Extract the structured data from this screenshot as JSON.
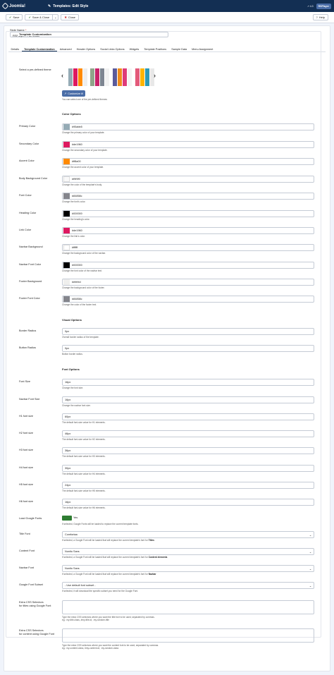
{
  "header": {
    "logo": "Joomla!",
    "title": "Templates: Edit Style",
    "ver": "↗ 4.3",
    "user": "RSPlayer"
  },
  "toolbar": {
    "save": "Save",
    "save_close": "Save & Close",
    "close": "Close",
    "help": "Help"
  },
  "style_name": {
    "label": "Style Name",
    "req": "*",
    "value": "RSPlayer - Full Width"
  },
  "tabs": [
    "Details",
    "Template Customization",
    "Advanced",
    "Header Options",
    "Social Links Options",
    "Widgets",
    "Template Positions",
    "Sample Data",
    "Menu Assignment"
  ],
  "legend": "Template Customization",
  "theme": {
    "label": "Select a pre-defined theme",
    "hint": "You can select one of the pre-defined themes",
    "customize": "Customize it!"
  },
  "sections": {
    "color": "Color Options",
    "visual": "Visual Options",
    "font": "Font Options"
  },
  "colors": [
    {
      "label": "Primary Color",
      "value": "#95abb5",
      "hint": "Change the primary color of your template."
    },
    {
      "label": "Secondary Color",
      "value": "#de1960",
      "hint": "Change the secondary color of your template."
    },
    {
      "label": "Accent Color",
      "value": "#ff8a00",
      "hint": "Change the accent color of your template."
    },
    {
      "label": "Body Background Color",
      "value": "#f9f9f9",
      "hint": "Change the color of the template's body."
    },
    {
      "label": "Font Color",
      "value": "#84858c",
      "hint": "Change the font's color."
    },
    {
      "label": "Heading Color",
      "value": "#000000",
      "hint": "Change the heading's color."
    },
    {
      "label": "Link Color",
      "value": "#de1960",
      "hint": "Change the link's color."
    },
    {
      "label": "Navbar Background",
      "value": "#ffffff",
      "hint": "Change the background color of the navbar."
    },
    {
      "label": "Navbar Font Color",
      "value": "#000000",
      "hint": "Change the font color of the navbar text."
    },
    {
      "label": "Footer Background",
      "value": "#efefed",
      "hint": "Change the background color of the footer."
    },
    {
      "label": "Footer Font Color",
      "value": "#84858c",
      "hint": "Change the color of the footer text."
    }
  ],
  "visual": [
    {
      "label": "Border Radius",
      "value": "0px",
      "hint": "Overall border radius of the template."
    },
    {
      "label": "Button Radius",
      "value": "0px",
      "hint": "Button border radius."
    }
  ],
  "fonts": [
    {
      "label": "Font Size",
      "value": "16px",
      "hint": "Change the font size."
    },
    {
      "label": "Navbar Font Size",
      "value": "16px",
      "hint": "Change the navbar font size."
    },
    {
      "label": "H1 font size",
      "value": "60px",
      "hint": "The default font-size value for H1 elements."
    },
    {
      "label": "H2 font size",
      "value": "46px",
      "hint": "The default font-size value for H2 elements."
    },
    {
      "label": "H3 font size",
      "value": "36px",
      "hint": "The default font-size value for H3 elements."
    },
    {
      "label": "H4 font size",
      "value": "30px",
      "hint": "The default font-size value for H4 elements."
    },
    {
      "label": "H5 font size",
      "value": "24px",
      "hint": "The default font-size value for H5 elements."
    },
    {
      "label": "H6 font size",
      "value": "16px",
      "hint": "The default font-size value for H6 elements."
    }
  ],
  "google": {
    "label": "Load Google Fonts",
    "value": "Yes",
    "hint": "If selected, Google Fonts will be loaded to replace the current template fonts."
  },
  "selects": [
    {
      "label": "Title Font",
      "value": "Comfortaa",
      "hint_pre": "If selected, a Google Font will be loaded that will replace the current template's font for ",
      "hint_b": "Titles"
    },
    {
      "label": "Content Font",
      "value": "Nunito Sans",
      "hint_pre": "If selected, a Google Font will be loaded that will replace the current template's font for ",
      "hint_b": "Content elements"
    },
    {
      "label": "Navbar Font",
      "value": "Nunito Sans",
      "hint_pre": "If selected, a Google Font will be loaded that will replace the current template's font for ",
      "hint_b": "Navbar"
    },
    {
      "label": "Google Font Subset",
      "value": "- Use default font subset -",
      "hint_pre": "If selected, it will download the specific subset you need for the Google Font.",
      "hint_b": ""
    }
  ],
  "extra": [
    {
      "l1": "Extra CSS Selectors",
      "l2": "for titles using Google Font",
      "h1": "Type the extra CSS selectors where you want the title font to be used, separated by commas.",
      "h2": "eg.: my-title-class, #my-title-id, .my-random-title"
    },
    {
      "l1": "Extra CSS Selectors",
      "l2": "for content using Google Font",
      "h1": "Type the extra CSS selectors where you want the content font to be used, separated by commas.",
      "h2": "eg.: my-content-class, #my-content-id, .my-random-class"
    }
  ],
  "palettes": [
    [
      "#95abb5",
      "#de1960",
      "#ff8a00",
      "#eeeeee"
    ],
    [
      "#8fa58a",
      "#c8226a",
      "#7e8591",
      "#f1f1f1"
    ],
    [
      "#5b5b9b",
      "#f08b1c",
      "#df3b78",
      "#f4f4f4"
    ],
    [
      "#e35a7a",
      "#ffb400",
      "#2c9ab7",
      "#e8e8e8"
    ]
  ]
}
